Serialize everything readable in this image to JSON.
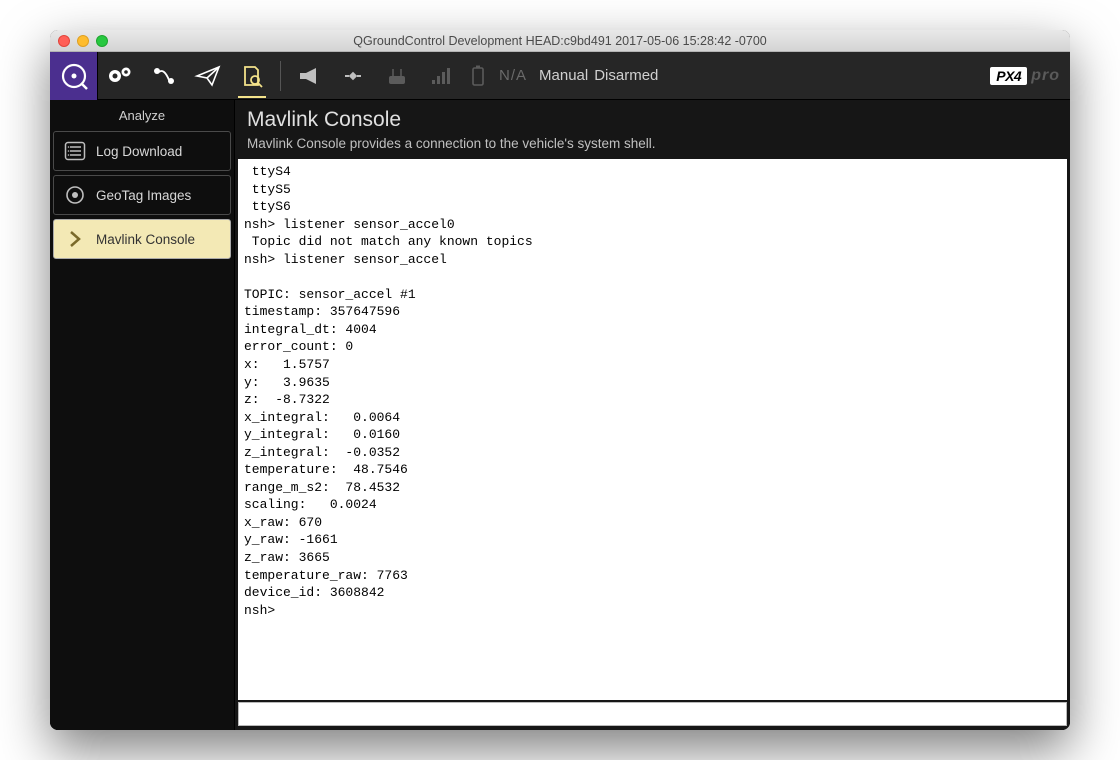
{
  "window": {
    "title": "QGroundControl Development HEAD:c9bd491 2017-05-06 15:28:42 -0700"
  },
  "toolbar": {
    "status_na": "N/A",
    "flight_mode": "Manual",
    "arm_state": "Disarmed",
    "brand_name": "PX4",
    "brand_suffix": "pro"
  },
  "sidebar": {
    "title": "Analyze",
    "items": [
      {
        "label": "Log Download"
      },
      {
        "label": "GeoTag Images"
      },
      {
        "label": "Mavlink Console"
      }
    ]
  },
  "main": {
    "title": "Mavlink Console",
    "subtitle": "Mavlink Console provides a connection to the vehicle's system shell.",
    "console_text": " ttyS4\n ttyS5\n ttyS6\nnsh> listener sensor_accel0\n Topic did not match any known topics\nnsh> listener sensor_accel\n\nTOPIC: sensor_accel #1\ntimestamp: 357647596\nintegral_dt: 4004\nerror_count: 0\nx:   1.5757\ny:   3.9635\nz:  -8.7322\nx_integral:   0.0064\ny_integral:   0.0160\nz_integral:  -0.0352\ntemperature:  48.7546\nrange_m_s2:  78.4532\nscaling:   0.0024\nx_raw: 670\ny_raw: -1661\nz_raw: 3665\ntemperature_raw: 7763\ndevice_id: 3608842\nnsh>",
    "input_value": ""
  }
}
